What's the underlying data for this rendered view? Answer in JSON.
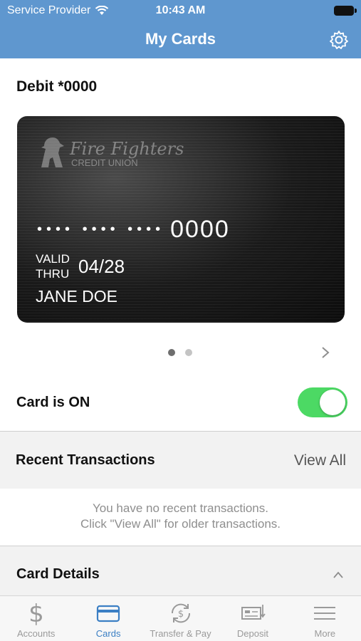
{
  "status_bar": {
    "carrier": "Service Provider",
    "time": "10:43 AM"
  },
  "header": {
    "title": "My Cards",
    "settings_icon": "gear-icon"
  },
  "card": {
    "name": "Debit *0000",
    "logo_brand": "Fire Fighters",
    "logo_sub": "CREDIT UNION",
    "masked_groups": "•••• •••• ••••",
    "last4": "0000",
    "valid_thru_label": "VALID THRU",
    "expiry": "04/28",
    "holder": "JANE DOE"
  },
  "pager": {
    "pages": 2,
    "active_index": 0
  },
  "card_status": {
    "label": "Card is ON",
    "enabled": true,
    "toggle_color": "#4cd964"
  },
  "recent_transactions": {
    "title": "Recent Transactions",
    "view_all": "View All",
    "empty_line1": "You have no recent transactions.",
    "empty_line2": "Click \"View All\" for older transactions."
  },
  "card_details": {
    "title": "Card Details",
    "expanded": true
  },
  "tabs": [
    {
      "label": "Accounts",
      "icon": "dollar-icon",
      "active": false
    },
    {
      "label": "Cards",
      "icon": "card-icon",
      "active": true
    },
    {
      "label": "Transfer & Pay",
      "icon": "transfer-icon",
      "active": false
    },
    {
      "label": "Deposit",
      "icon": "deposit-check-icon",
      "active": false
    },
    {
      "label": "More",
      "icon": "menu-icon",
      "active": false
    }
  ],
  "colors": {
    "header": "#5f97cf",
    "accent": "#3b7fc4",
    "tab_inactive": "#9a9a9a"
  }
}
